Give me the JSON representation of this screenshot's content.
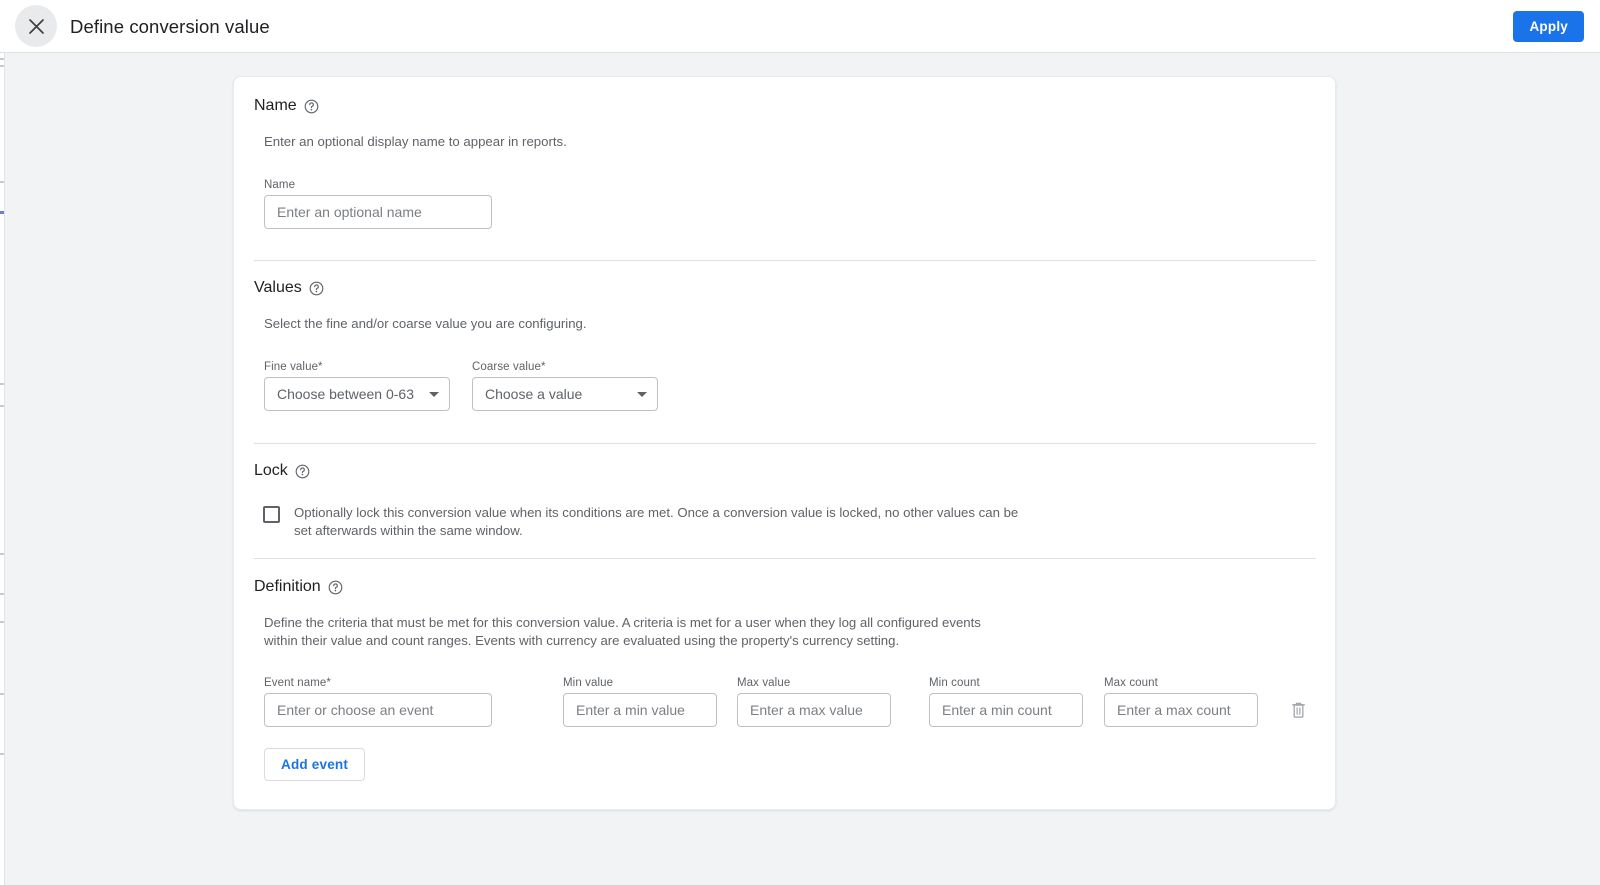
{
  "header": {
    "title": "Define conversion value",
    "close_icon": "close-icon",
    "apply_label": "Apply"
  },
  "colors": {
    "accent": "#1a73e8",
    "page_bg": "#f1f3f4",
    "card_bg": "#ffffff",
    "text_primary": "#202124",
    "text_secondary": "#5f6368",
    "border": "#bdc1c6",
    "divider": "#e0e0e0"
  },
  "sections": {
    "name": {
      "title": "Name",
      "help_icon": "help-circle-icon",
      "description": "Enter an optional display name to appear in reports.",
      "field_label": "Name",
      "field_placeholder": "Enter an optional name",
      "field_value": ""
    },
    "values": {
      "title": "Values",
      "help_icon": "help-circle-icon",
      "description": "Select the fine and/or coarse value you are configuring.",
      "fine": {
        "label": "Fine value*",
        "selected": "Choose between 0-63",
        "caret_icon": "chevron-down-icon"
      },
      "coarse": {
        "label": "Coarse value*",
        "selected": "Choose a value",
        "caret_icon": "chevron-down-icon"
      }
    },
    "lock": {
      "title": "Lock",
      "help_icon": "help-circle-icon",
      "checkbox_checked": false,
      "checkbox_label_line1": "Optionally lock this conversion value when its conditions are met. Once a conversion value is locked, no other values can be",
      "checkbox_label_line2": "set afterwards within the same window."
    },
    "definition": {
      "title": "Definition",
      "help_icon": "help-circle-icon",
      "description_line1": "Define the criteria that must be met for this conversion value. A criteria is met for a user when they log all configured events",
      "description_line2": "within their value and count ranges. Events with currency are evaluated using the property's currency setting.",
      "columns": [
        {
          "label": "Event name*",
          "placeholder": "Enter or choose an event",
          "value": ""
        },
        {
          "label": "Min value",
          "placeholder": "Enter a min value",
          "value": ""
        },
        {
          "label": "Max value",
          "placeholder": "Enter a max value",
          "value": ""
        },
        {
          "label": "Min count",
          "placeholder": "Enter a min count",
          "value": ""
        },
        {
          "label": "Max count",
          "placeholder": "Enter a max count",
          "value": ""
        }
      ],
      "delete_icon": "trash-icon",
      "add_event_label": "Add event"
    }
  }
}
